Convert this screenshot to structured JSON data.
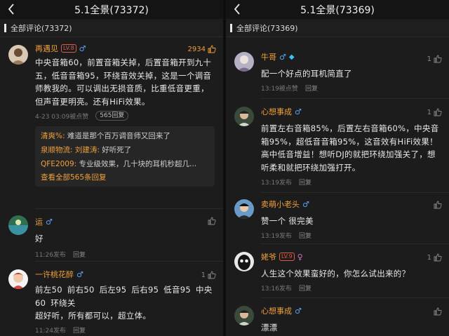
{
  "left": {
    "title": "5.1全景(73372)",
    "section_label": "全部评论(73372)",
    "comments": [
      {
        "name": "再遇见",
        "level": "LV.8",
        "gender": "♂",
        "likes": "2934",
        "text": "中央音箱60，前置音箱关掉，后置音箱开到九十五，低音音箱95，环绕音效关掉，这是一个调音师教我的。可以调出无损音质，比重低音更重，但声音更明亮。还有HiFi效果。",
        "time": "4-23 03:09被点赞",
        "reply_badge": "565回复",
        "replies": [
          {
            "who": "清爽%:",
            "text": " 难道是那个百万调音师又回来了"
          },
          {
            "who": "泉顺物流:",
            "text": " ",
            "who2": "刘建涛:",
            "text2": " 好听死了"
          },
          {
            "who": "QFE2009:",
            "text": " 专业级效果，几十块的耳机秒超几..."
          }
        ],
        "view_all": "查看全部565条回复"
      },
      {
        "name": "运",
        "gender": "♂",
        "text": "好",
        "time": "11:26发布",
        "reply": "回复"
      },
      {
        "name": "一许桃花醉",
        "gender": "♂",
        "likes": "1",
        "text": "前左50  前右50  后左95  后右95  低音95  中央60  环绕关\n超好听，所有都可以，超立体。",
        "time": "11:24发布",
        "reply": "回复"
      }
    ]
  },
  "right": {
    "title": "5.1全景(73369)",
    "section_label": "全部评论(73369)",
    "comments": [
      {
        "name": "牛哥",
        "gender": "♂",
        "likes": "1",
        "text": "配一个好点的耳机简直了",
        "time": "13:19被点赞",
        "reply": "回复"
      },
      {
        "name": "心想事成",
        "gender": "♂",
        "likes": "1",
        "text": "前置左右音箱85%，后置左右音箱60%，中央音箱95%，超低音音箱95%，这音效有HiFi效果！高中低音增益！想听DJ的就把环绕加强关了，想听柔和就把环绕加强打开。",
        "time": "13:19发布",
        "reply": "回复"
      },
      {
        "name": "卖萌小老头",
        "gender": "♂",
        "text": "赞一个 很完美",
        "time": "13:19发布",
        "reply": "回复"
      },
      {
        "name": "姥爷",
        "level": "LV.9",
        "gender": "♀",
        "likes": "1",
        "text": "人生这个效果蛮好的，你怎么试出来的？",
        "time": "13:16发布",
        "reply": "回复"
      },
      {
        "name": "心想事成",
        "gender": "♂",
        "text": "漂漂",
        "time": "",
        "reply": ""
      }
    ]
  }
}
